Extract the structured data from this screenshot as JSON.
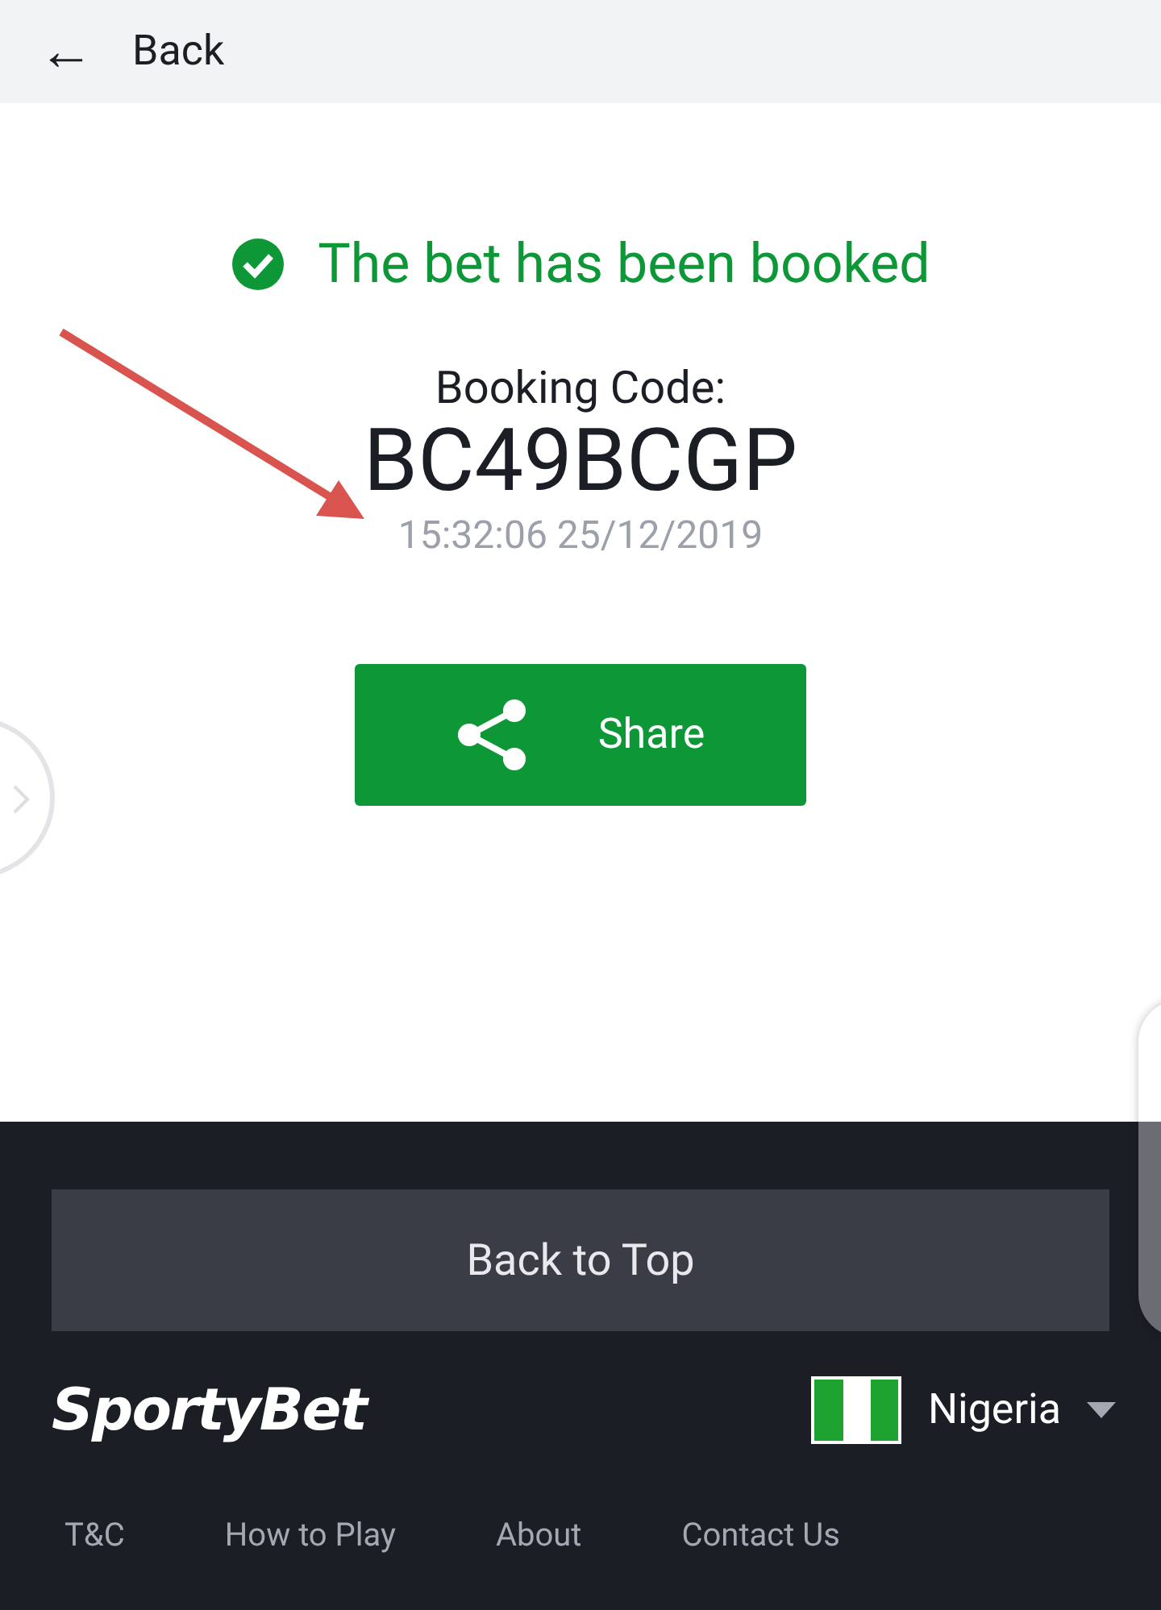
{
  "header": {
    "back_icon": "←",
    "back_label": "Back"
  },
  "confirmation": {
    "message": "The bet has been booked",
    "booking_label": "Booking Code:",
    "booking_code": "BC49BCGP",
    "timestamp": "15:32:06 25/12/2019",
    "share_label": "Share"
  },
  "footer": {
    "back_to_top": "Back to Top",
    "logo": "SportyBet",
    "country": "Nigeria",
    "links": [
      "T&C",
      "How to Play",
      "About",
      "Contact Us"
    ]
  }
}
